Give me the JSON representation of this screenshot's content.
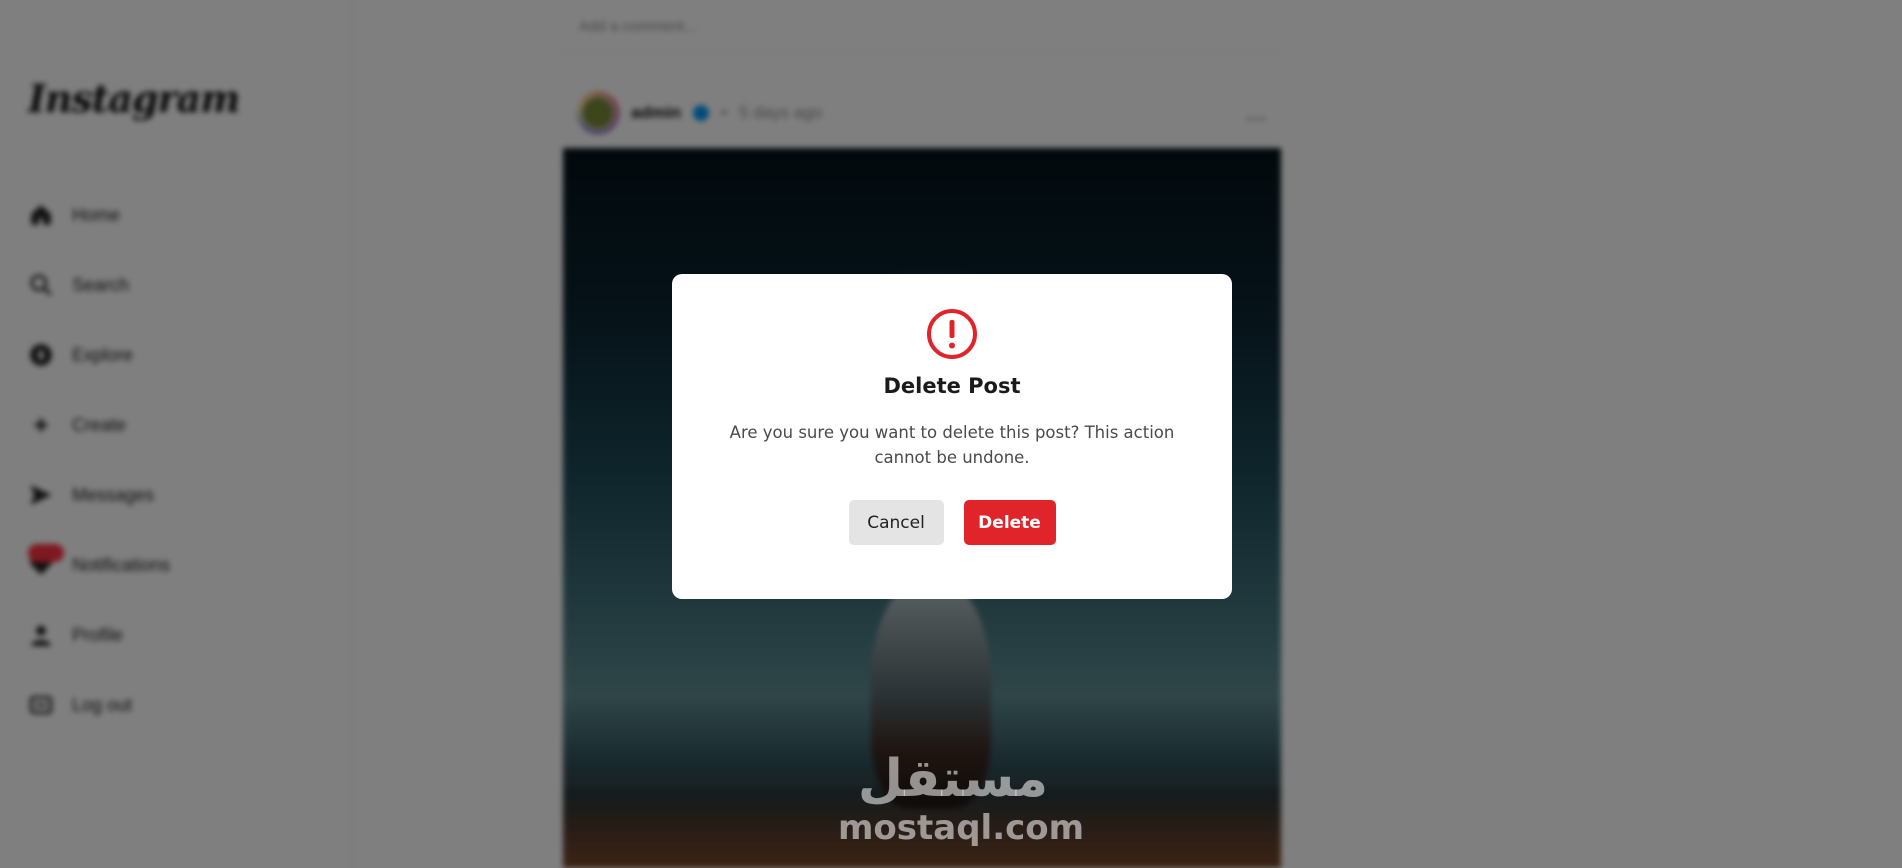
{
  "sidebar": {
    "logo": "Instagram",
    "items": [
      {
        "label": "Home",
        "icon": "home-icon"
      },
      {
        "label": "Search",
        "icon": "search-icon"
      },
      {
        "label": "Explore",
        "icon": "explore-icon"
      },
      {
        "label": "Create",
        "icon": "plus-icon"
      },
      {
        "label": "Messages",
        "icon": "send-icon"
      },
      {
        "label": "Notifications",
        "icon": "heart-icon"
      },
      {
        "label": "Profile",
        "icon": "user-icon"
      },
      {
        "label": "Log out",
        "icon": "logout-icon"
      }
    ]
  },
  "feed": {
    "comment_placeholder": "Add a comment...",
    "post": {
      "username": "admin",
      "separator": "•",
      "time": "5 days ago",
      "more": "..."
    }
  },
  "watermark": {
    "arabic": "مستقل",
    "latin": "mostaql.com"
  },
  "modal": {
    "icon": "alert-circle-icon",
    "title": "Delete Post",
    "message": "Are you sure you want to delete this post? This action cannot be undone.",
    "cancel_label": "Cancel",
    "delete_label": "Delete"
  },
  "colors": {
    "overlay": "#808080",
    "danger": "#e0242a",
    "cancel_bg": "#e4e4e4",
    "modal_bg": "#ffffff"
  }
}
